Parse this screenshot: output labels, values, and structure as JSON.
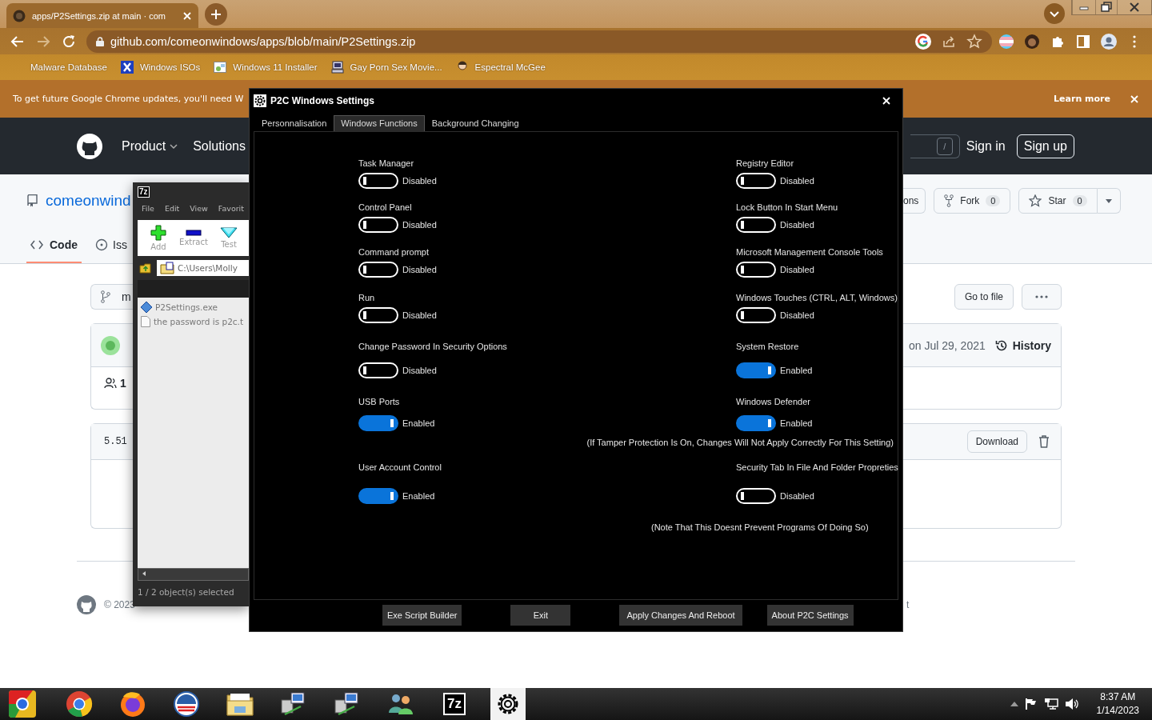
{
  "browser": {
    "tab": {
      "title": "apps/P2Settings.zip at main · com"
    },
    "address": "github.com/comeonwindows/apps/blob/main/P2Settings.zip",
    "bookmarks": [
      {
        "label": "Malware Database",
        "kind": "none"
      },
      {
        "label": "Windows ISOs",
        "kind": "x-logo"
      },
      {
        "label": "Windows 11 Installer",
        "kind": "image"
      },
      {
        "label": "Gay Porn Sex Movie...",
        "kind": "computer"
      },
      {
        "label": "Espectral McGee",
        "kind": "figure"
      }
    ]
  },
  "update_banner": {
    "text": "To get future Google Chrome updates, you'll need W",
    "link": "Learn more"
  },
  "github": {
    "nav": [
      "Product",
      "Solutions"
    ],
    "search_key": "/",
    "sign_in": "Sign in",
    "sign_up": "Sign up",
    "repo_name": "comeonwind",
    "partial_button": "ons",
    "fork": {
      "label": "Fork",
      "count": "0"
    },
    "star": {
      "label": "Star",
      "count": "0"
    },
    "tabs": [
      {
        "label": "Code",
        "selected": true
      },
      {
        "label": "Iss",
        "selected": false
      }
    ],
    "branch": "m",
    "go_to_file": "Go to file",
    "commit": {
      "date": "on Jul 29, 2021",
      "history": "History",
      "contributors": "1"
    },
    "file": {
      "size": "5.51",
      "download": "Download"
    },
    "footer": {
      "copyright": "© 2023",
      "link": "t"
    }
  },
  "archiver": {
    "icon_text": "7z",
    "menu": [
      "File",
      "Edit",
      "View",
      "Favorit"
    ],
    "toolbar": [
      {
        "label": "Add",
        "kind": "add"
      },
      {
        "label": "Extract",
        "kind": "extract"
      },
      {
        "label": "Test",
        "kind": "test"
      }
    ],
    "path": "C:\\Users\\Molly",
    "files": [
      {
        "name": "P2Settings.exe",
        "kind": "exe"
      },
      {
        "name": "the password is p2c.t",
        "kind": "text"
      }
    ],
    "status": "1 / 2 object(s) selected"
  },
  "dialog": {
    "title": "P2C Windows Settings",
    "tabs": [
      {
        "label": "Personnalisation",
        "selected": false
      },
      {
        "label": "Windows Functions",
        "selected": true
      },
      {
        "label": "Background Changing",
        "selected": false
      }
    ],
    "left": [
      {
        "label": "Task Manager",
        "on": false,
        "state": "Disabled"
      },
      {
        "label": "Control Panel",
        "on": false,
        "state": "Disabled"
      },
      {
        "label": "Command prompt",
        "on": false,
        "state": "Disabled"
      },
      {
        "label": "Run",
        "on": false,
        "state": "Disabled"
      },
      {
        "label": "Change Password In Security Options",
        "on": false,
        "state": "Disabled"
      },
      {
        "label": "USB Ports",
        "on": true,
        "state": "Enabled"
      },
      {
        "label": "User Account Control",
        "on": true,
        "state": "Enabled"
      }
    ],
    "right": [
      {
        "label": "Registry Editor",
        "on": false,
        "state": "Disabled"
      },
      {
        "label": "Lock Button In Start Menu",
        "on": false,
        "state": "Disabled"
      },
      {
        "label": "Microsoft Management Console Tools",
        "on": false,
        "state": "Disabled"
      },
      {
        "label": "Windows Touches (CTRL, ALT, Windows)",
        "on": false,
        "state": "Disabled"
      },
      {
        "label": "System Restore",
        "on": true,
        "state": "Enabled"
      },
      {
        "label": "Windows Defender",
        "on": true,
        "state": "Enabled",
        "note": "(If Tamper Protection Is On, Changes Will Not Apply Correctly For This Setting)"
      },
      {
        "label": "Security Tab In File And Folder Propreties",
        "on": false,
        "state": "Disabled",
        "note": "(Note That This Doesnt Prevent Programs Of Doing So)"
      }
    ],
    "buttons": [
      "Exe Script Builder",
      "Exit",
      "Apply Changes And Reboot",
      "About P2C Settings"
    ]
  },
  "taskbar": {
    "apps": [
      {
        "kind": "chromium",
        "selected": false
      },
      {
        "kind": "chrome",
        "selected": false
      },
      {
        "kind": "firefox",
        "selected": false
      },
      {
        "kind": "circle-logo",
        "selected": false
      },
      {
        "kind": "folder",
        "selected": false
      },
      {
        "kind": "computer",
        "selected": false
      },
      {
        "kind": "computer",
        "selected": false
      },
      {
        "kind": "users",
        "selected": false
      },
      {
        "kind": "archive",
        "label": "7z",
        "selected": false
      },
      {
        "kind": "gear",
        "selected": true
      }
    ],
    "time": "8:37 AM",
    "date": "1/14/2023"
  }
}
